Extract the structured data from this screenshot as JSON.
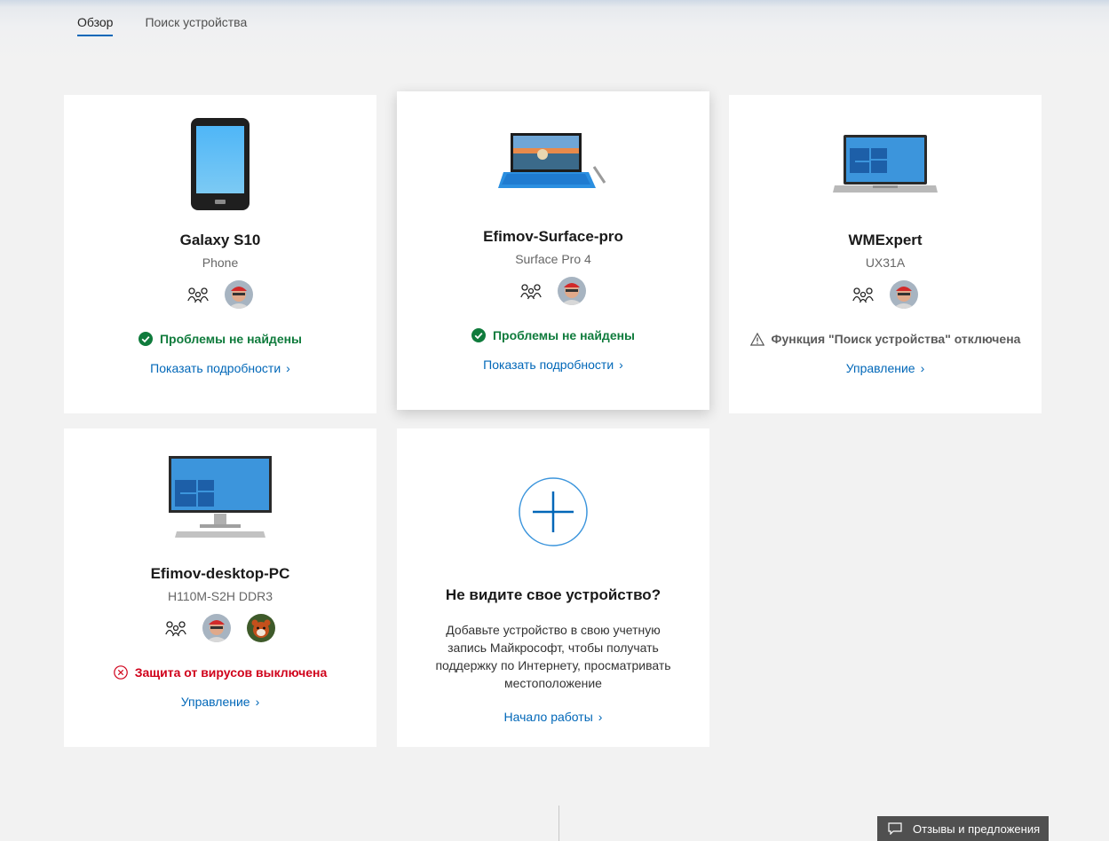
{
  "tabs": [
    {
      "label": "Обзор",
      "active": true
    },
    {
      "label": "Поиск устройства",
      "active": false
    }
  ],
  "devices": [
    {
      "name": "Galaxy S10",
      "model": "Phone",
      "icon": "phone-device-icon",
      "status": "Проблемы не найдены",
      "status_type": "ok",
      "link": "Показать подробности"
    },
    {
      "name": "Efimov-Surface-pro",
      "model": "Surface Pro 4",
      "icon": "surface-tablet-icon",
      "status": "Проблемы не найдены",
      "status_type": "ok",
      "link": "Показать подробности"
    },
    {
      "name": "WMExpert",
      "model": "UX31A",
      "icon": "laptop-device-icon",
      "status": "Функция \"Поиск устройства\" отключена",
      "status_type": "warning",
      "link": "Управление"
    },
    {
      "name": "Efimov-desktop-PC",
      "model": "H110M-S2H DDR3",
      "icon": "desktop-device-icon",
      "status": "Защита от вирусов выключена",
      "status_type": "error",
      "link": "Управление"
    }
  ],
  "add_device": {
    "title": "Не видите свое устройство?",
    "description": "Добавьте устройство в свою учетную запись Майкрософт, чтобы получать поддержку по Интернету, просматривать местоположение",
    "link": "Начало работы"
  },
  "feedback": {
    "label": "Отзывы и предложения"
  },
  "colors": {
    "accent": "#0067b8",
    "ok": "#0f7b3c",
    "error": "#d0021b",
    "background": "#f2f2f2"
  }
}
